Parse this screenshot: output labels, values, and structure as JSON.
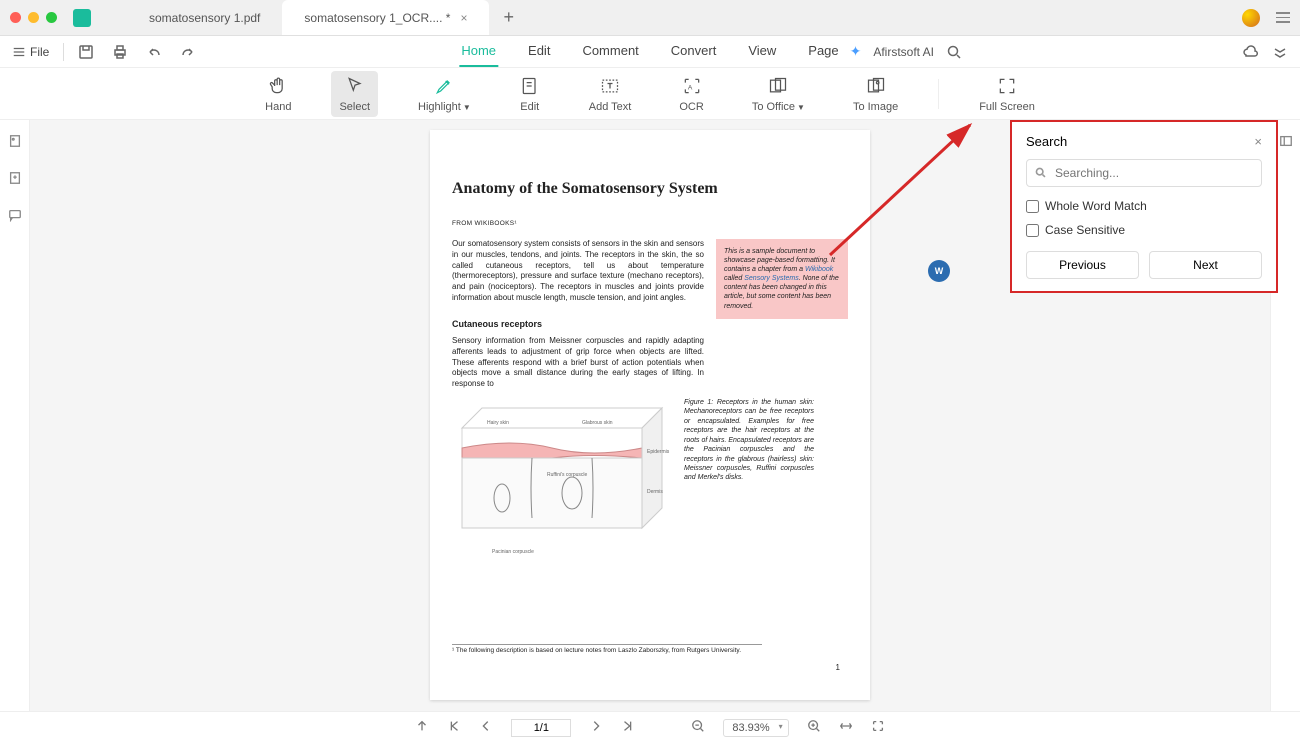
{
  "titlebar": {
    "tab1": "somatosensory 1.pdf",
    "tab2": "somatosensory 1_OCR.... *"
  },
  "menubar": {
    "file": "File",
    "menus": [
      "Home",
      "Edit",
      "Comment",
      "Convert",
      "View",
      "Page"
    ],
    "ai_label": "Afirstsoft AI"
  },
  "toolbar": {
    "hand": "Hand",
    "select": "Select",
    "highlight": "Highlight",
    "edit": "Edit",
    "addtext": "Add Text",
    "ocr": "OCR",
    "tooffice": "To Office",
    "toimage": "To Image",
    "fullscreen": "Full Screen"
  },
  "document": {
    "title": "Anatomy of the Somatosensory System",
    "source": "FROM WIKIBOOKS¹",
    "para1": "Our somatosensory system consists of sensors in the skin and sensors in our muscles, tendons, and joints. The receptors in the skin, the so called cutaneous receptors, tell us about temperature (thermoreceptors), pressure and surface texture (mechano receptors), and pain (nociceptors). The receptors in muscles and joints provide information about muscle length, muscle tension, and joint angles.",
    "pinkbox_pre": "This is a sample document to showcase page-based formatting. It contains a chapter from a",
    "pinkbox_link1": "Wikibook",
    "pinkbox_mid": "called",
    "pinkbox_link2": "Sensory Systems",
    "pinkbox_post": ". None of the content has been changed in this article, but some content has been removed.",
    "subhead": "Cutaneous receptors",
    "para2": "Sensory information from Meissner corpuscles and rapidly adapting afferents leads to adjustment of grip force when objects are lifted. These afferents respond with a brief burst of action potentials when objects move a small distance during the early stages of lifting. In response to",
    "figcap": "Figure 1: Receptors in the human skin: Mechanoreceptors can be free receptors or encapsulated. Examples for free receptors are the hair receptors at the roots of hairs. Encapsulated receptors are the Pacinian corpuscles and the receptors in the glabrous (hairless) skin: Meissner corpuscles, Ruffini corpuscles and Merkel's disks.",
    "footnote": "¹ The following description is based on lecture notes from Laszlo Zaborszky, from Rutgers University.",
    "pageno": "1",
    "word_badge": "W"
  },
  "search": {
    "title": "Search",
    "placeholder": "Searching...",
    "whole": "Whole Word Match",
    "case": "Case Sensitive",
    "prev": "Previous",
    "next": "Next"
  },
  "bottombar": {
    "page": "1/1",
    "zoom": "83.93%"
  }
}
